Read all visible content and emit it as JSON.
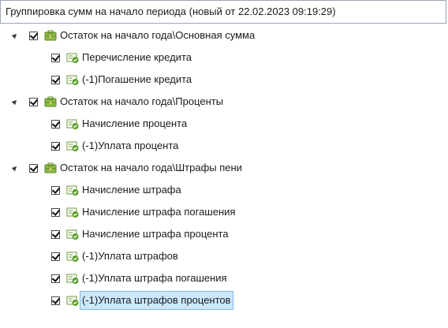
{
  "header": {
    "title": "Группировка сумм на начало периода (новый от 22.02.2023 09:19:29)"
  },
  "tree": {
    "groups": [
      {
        "label": "Остаток на начало года\\Основная сумма",
        "checked": true,
        "expanded": true,
        "items": [
          {
            "label": "Перечисление кредита",
            "checked": true
          },
          {
            "label": "(-1)Погашение кредита",
            "checked": true
          }
        ]
      },
      {
        "label": "Остаток на начало года\\Проценты",
        "checked": true,
        "expanded": true,
        "items": [
          {
            "label": "Начисление процента",
            "checked": true
          },
          {
            "label": "(-1)Уплата процента",
            "checked": true
          }
        ]
      },
      {
        "label": "Остаток на начало года\\Штрафы пени",
        "checked": true,
        "expanded": true,
        "items": [
          {
            "label": "Начисление штрафа",
            "checked": true
          },
          {
            "label": "Начисление штрафа погашения",
            "checked": true
          },
          {
            "label": "Начисление штрафа процента",
            "checked": true
          },
          {
            "label": "(-1)Уплата штрафов",
            "checked": true
          },
          {
            "label": "(-1)Уплата штрафа погашения",
            "checked": true
          },
          {
            "label": "(-1)Уплата штрафов процентов",
            "checked": true,
            "selected": true
          }
        ]
      }
    ]
  },
  "colors": {
    "selection": "#cce8ff",
    "folder_icon": "#7fb03a",
    "item_icon": "#5a9a2a"
  }
}
